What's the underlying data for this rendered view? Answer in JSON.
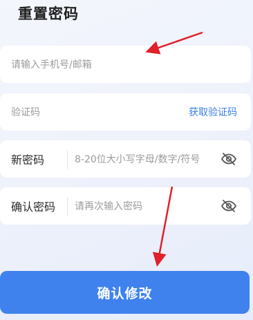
{
  "page": {
    "title": "重置密码"
  },
  "account": {
    "placeholder": "请输入手机号/邮箱"
  },
  "code": {
    "placeholder": "验证码",
    "get_code_label": "获取验证码"
  },
  "new_password": {
    "label": "新密码",
    "placeholder": "8-20位大小写字母/数字/符号",
    "icon": "eye-off-icon"
  },
  "confirm_password": {
    "label": "确认密码",
    "placeholder": "请再次输入密码",
    "icon": "eye-off-icon"
  },
  "submit": {
    "label": "确认修改"
  },
  "colors": {
    "accent": "#3f82ee",
    "link": "#3b7de8",
    "annotation": "#e0202a"
  }
}
